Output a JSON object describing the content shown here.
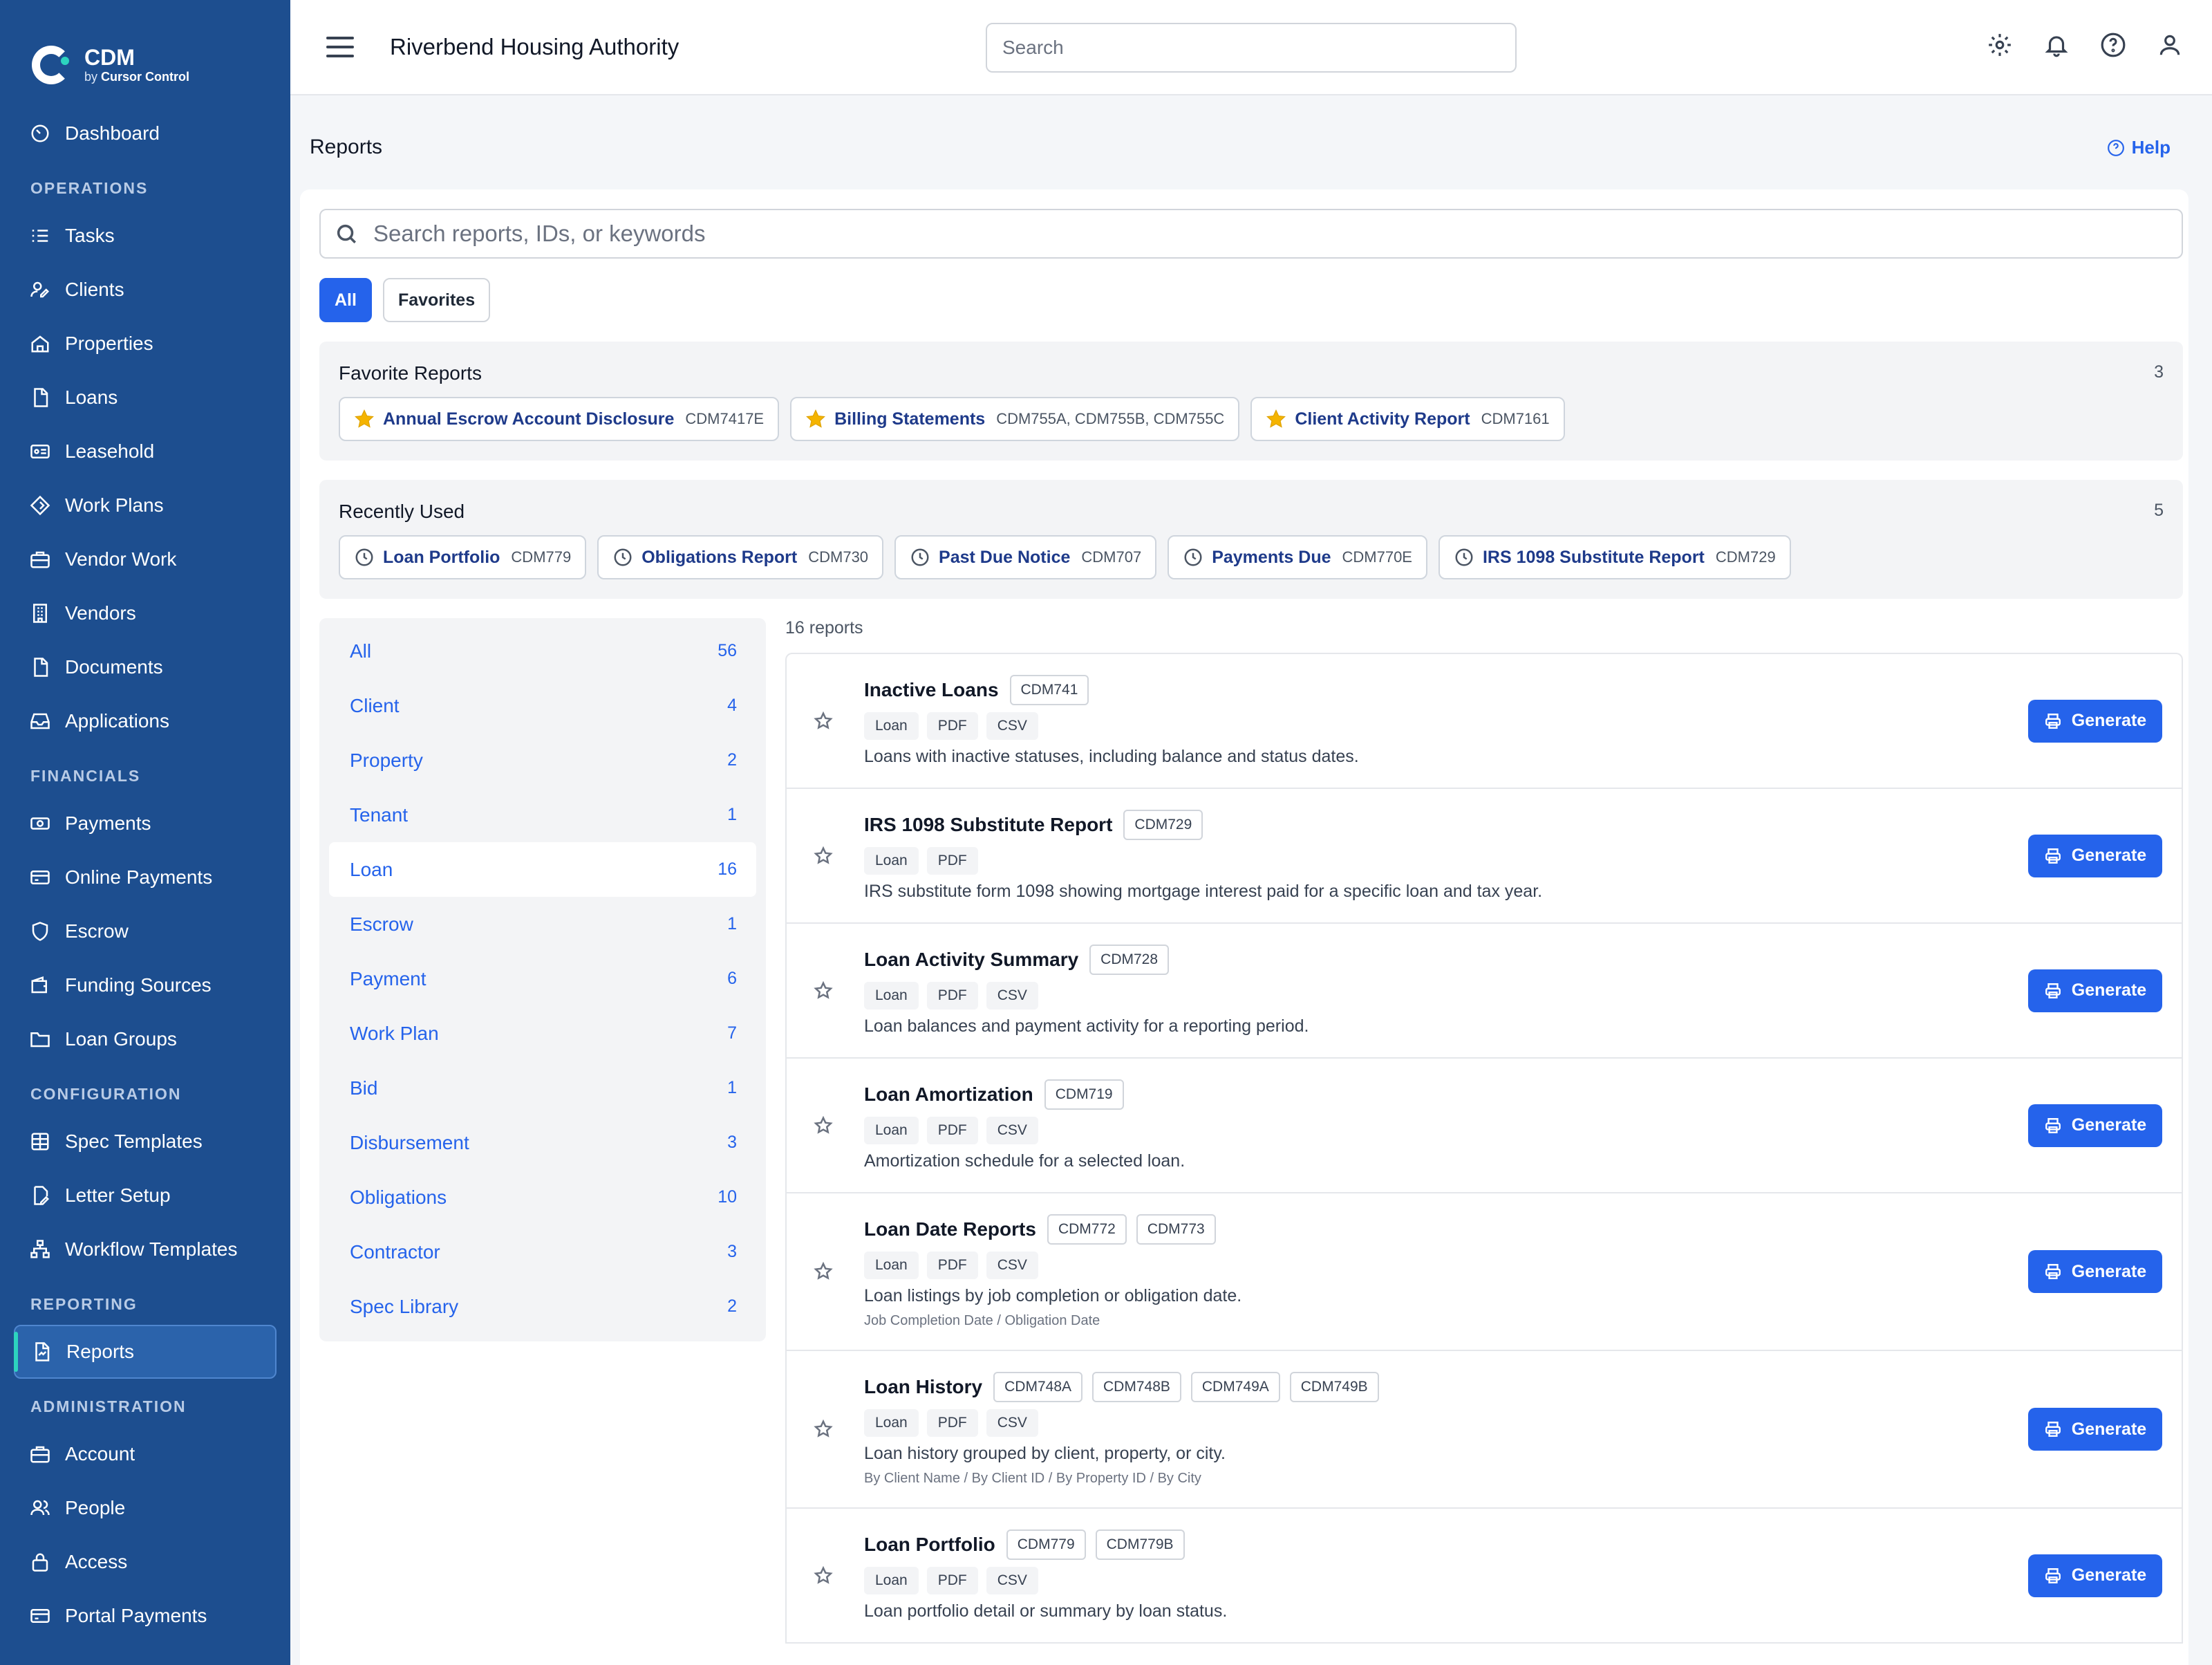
{
  "brand": {
    "name": "CDM",
    "by": "by",
    "company": "Cursor Control"
  },
  "sidebar": {
    "dashboard": {
      "label": "Dashboard",
      "icon": "gauge-icon"
    },
    "sections": [
      {
        "title": "OPERATIONS",
        "items": [
          {
            "label": "Tasks",
            "icon": "list-icon"
          },
          {
            "label": "Clients",
            "icon": "user-edit-icon"
          },
          {
            "label": "Properties",
            "icon": "home-icon"
          },
          {
            "label": "Loans",
            "icon": "file-icon"
          },
          {
            "label": "Leasehold",
            "icon": "id-card-icon"
          },
          {
            "label": "Work Plans",
            "icon": "diamond-icon"
          },
          {
            "label": "Vendor Work",
            "icon": "briefcase-icon"
          },
          {
            "label": "Vendors",
            "icon": "building-icon"
          },
          {
            "label": "Documents",
            "icon": "document-icon"
          },
          {
            "label": "Applications",
            "icon": "inbox-icon"
          }
        ]
      },
      {
        "title": "FINANCIALS",
        "items": [
          {
            "label": "Payments",
            "icon": "cash-icon"
          },
          {
            "label": "Online Payments",
            "icon": "credit-card-icon"
          },
          {
            "label": "Escrow",
            "icon": "shield-icon"
          },
          {
            "label": "Funding Sources",
            "icon": "wallet-icon"
          },
          {
            "label": "Loan Groups",
            "icon": "folder-icon"
          }
        ]
      },
      {
        "title": "CONFIGURATION",
        "items": [
          {
            "label": "Spec Templates",
            "icon": "table-icon"
          },
          {
            "label": "Letter Setup",
            "icon": "file-edit-icon"
          },
          {
            "label": "Workflow Templates",
            "icon": "workflow-icon"
          }
        ]
      },
      {
        "title": "REPORTING",
        "items": [
          {
            "label": "Reports",
            "icon": "report-icon",
            "active": true
          }
        ]
      },
      {
        "title": "ADMINISTRATION",
        "items": [
          {
            "label": "Account",
            "icon": "briefcase-icon"
          },
          {
            "label": "People",
            "icon": "people-icon"
          },
          {
            "label": "Access",
            "icon": "lock-icon"
          },
          {
            "label": "Portal Payments",
            "icon": "credit-card-icon"
          }
        ]
      }
    ]
  },
  "topbar": {
    "org_name": "Riverbend Housing Authority",
    "search_placeholder": "Search",
    "icons": [
      "gear-icon",
      "bell-icon",
      "help-circle-icon",
      "user-icon"
    ]
  },
  "page": {
    "title": "Reports",
    "help_label": "Help"
  },
  "report_search": {
    "placeholder": "Search reports, IDs, or keywords"
  },
  "tabs": [
    {
      "label": "All",
      "active": true
    },
    {
      "label": "Favorites",
      "active": false
    }
  ],
  "favorites": {
    "title": "Favorite Reports",
    "count": "3",
    "items": [
      {
        "name": "Annual Escrow Account Disclosure",
        "code": "CDM7417E"
      },
      {
        "name": "Billing Statements",
        "code": "CDM755A, CDM755B, CDM755C"
      },
      {
        "name": "Client Activity Report",
        "code": "CDM7161"
      }
    ]
  },
  "recent": {
    "title": "Recently Used",
    "count": "5",
    "items": [
      {
        "name": "Loan Portfolio",
        "code": "CDM779"
      },
      {
        "name": "Obligations Report",
        "code": "CDM730"
      },
      {
        "name": "Past Due Notice",
        "code": "CDM707"
      },
      {
        "name": "Payments Due",
        "code": "CDM770E"
      },
      {
        "name": "IRS 1098 Substitute Report",
        "code": "CDM729"
      }
    ]
  },
  "categories": [
    {
      "label": "All",
      "count": "56"
    },
    {
      "label": "Client",
      "count": "4"
    },
    {
      "label": "Property",
      "count": "2"
    },
    {
      "label": "Tenant",
      "count": "1"
    },
    {
      "label": "Loan",
      "count": "16",
      "active": true
    },
    {
      "label": "Escrow",
      "count": "1"
    },
    {
      "label": "Payment",
      "count": "6"
    },
    {
      "label": "Work Plan",
      "count": "7"
    },
    {
      "label": "Bid",
      "count": "1"
    },
    {
      "label": "Disbursement",
      "count": "3"
    },
    {
      "label": "Obligations",
      "count": "10"
    },
    {
      "label": "Contractor",
      "count": "3"
    },
    {
      "label": "Spec Library",
      "count": "2"
    }
  ],
  "report_count_label": "16 reports",
  "generate_label": "Generate",
  "reports": [
    {
      "title": "Inactive Loans",
      "codes": [
        "CDM741"
      ],
      "tags": [
        "Loan",
        "PDF",
        "CSV"
      ],
      "desc": "Loans with inactive statuses, including balance and status dates.",
      "sub": ""
    },
    {
      "title": "IRS 1098 Substitute Report",
      "codes": [
        "CDM729"
      ],
      "tags": [
        "Loan",
        "PDF"
      ],
      "desc": "IRS substitute form 1098 showing mortgage interest paid for a specific loan and tax year.",
      "sub": ""
    },
    {
      "title": "Loan Activity Summary",
      "codes": [
        "CDM728"
      ],
      "tags": [
        "Loan",
        "PDF",
        "CSV"
      ],
      "desc": "Loan balances and payment activity for a reporting period.",
      "sub": ""
    },
    {
      "title": "Loan Amortization",
      "codes": [
        "CDM719"
      ],
      "tags": [
        "Loan",
        "PDF",
        "CSV"
      ],
      "desc": "Amortization schedule for a selected loan.",
      "sub": ""
    },
    {
      "title": "Loan Date Reports",
      "codes": [
        "CDM772",
        "CDM773"
      ],
      "tags": [
        "Loan",
        "PDF",
        "CSV"
      ],
      "desc": "Loan listings by job completion or obligation date.",
      "sub": "Job Completion Date / Obligation Date"
    },
    {
      "title": "Loan History",
      "codes": [
        "CDM748A",
        "CDM748B",
        "CDM749A",
        "CDM749B"
      ],
      "tags": [
        "Loan",
        "PDF",
        "CSV"
      ],
      "desc": "Loan history grouped by client, property, or city.",
      "sub": "By Client Name / By Client ID / By Property ID / By City"
    },
    {
      "title": "Loan Portfolio",
      "codes": [
        "CDM779",
        "CDM779B"
      ],
      "tags": [
        "Loan",
        "PDF",
        "CSV"
      ],
      "desc": "Loan portfolio detail or summary by loan status.",
      "sub": ""
    }
  ]
}
